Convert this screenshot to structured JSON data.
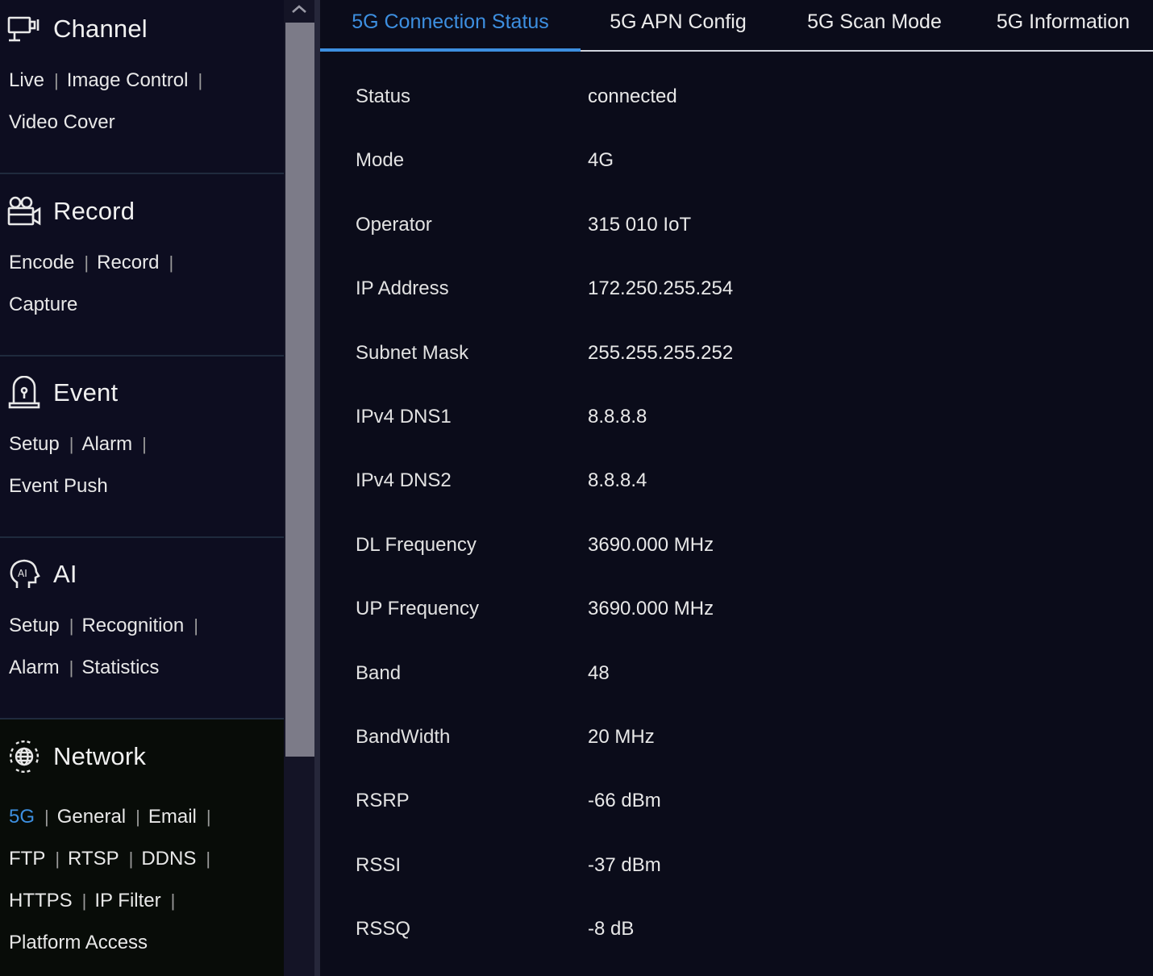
{
  "sidebar": {
    "sections": [
      {
        "title": "Channel",
        "icon": "channel-icon",
        "lines": [
          [
            "Live",
            "Image Control"
          ],
          [
            "Video Cover"
          ]
        ],
        "active": false
      },
      {
        "title": "Record",
        "icon": "record-icon",
        "lines": [
          [
            "Encode",
            "Record"
          ],
          [
            "Capture"
          ]
        ],
        "active": false
      },
      {
        "title": "Event",
        "icon": "event-icon",
        "lines": [
          [
            "Setup",
            "Alarm"
          ],
          [
            "Event Push"
          ]
        ],
        "active": false
      },
      {
        "title": "AI",
        "icon": "ai-icon",
        "lines": [
          [
            "Setup",
            "Recognition"
          ],
          [
            "Alarm",
            "Statistics"
          ]
        ],
        "active": false
      },
      {
        "title": "Network",
        "icon": "network-icon",
        "lines": [
          [
            "5G",
            "General",
            "Email"
          ],
          [
            "FTP",
            "RTSP",
            "DDNS"
          ],
          [
            "HTTPS",
            "IP Filter"
          ],
          [
            "Platform Access"
          ]
        ],
        "active": true,
        "current_link": "5G"
      }
    ],
    "separator": "|"
  },
  "tabs": [
    {
      "label": "5G Connection Status",
      "active": true
    },
    {
      "label": "5G APN Config",
      "active": false
    },
    {
      "label": "5G Scan Mode",
      "active": false
    },
    {
      "label": "5G Information",
      "active": false
    }
  ],
  "status_rows": [
    {
      "label": "Status",
      "value": "connected"
    },
    {
      "label": "Mode",
      "value": "4G"
    },
    {
      "label": "Operator",
      "value": "315 010 IoT"
    },
    {
      "label": "IP Address",
      "value": "172.250.255.254"
    },
    {
      "label": "Subnet Mask",
      "value": "255.255.255.252"
    },
    {
      "label": "IPv4 DNS1",
      "value": "8.8.8.8"
    },
    {
      "label": "IPv4 DNS2",
      "value": "8.8.8.4"
    },
    {
      "label": "DL Frequency",
      "value": "3690.000 MHz"
    },
    {
      "label": "UP Frequency",
      "value": "3690.000 MHz"
    },
    {
      "label": "Band",
      "value": "48"
    },
    {
      "label": "BandWidth",
      "value": "20 MHz"
    },
    {
      "label": "RSRP",
      "value": "-66 dBm"
    },
    {
      "label": "RSSI",
      "value": "-37 dBm"
    },
    {
      "label": "RSSQ",
      "value": "-8 dB"
    }
  ],
  "colors": {
    "accent": "#3d8fe0",
    "background": "#0b0c1a",
    "sidebar": "#0d0d20",
    "active_section": "#080c08"
  }
}
